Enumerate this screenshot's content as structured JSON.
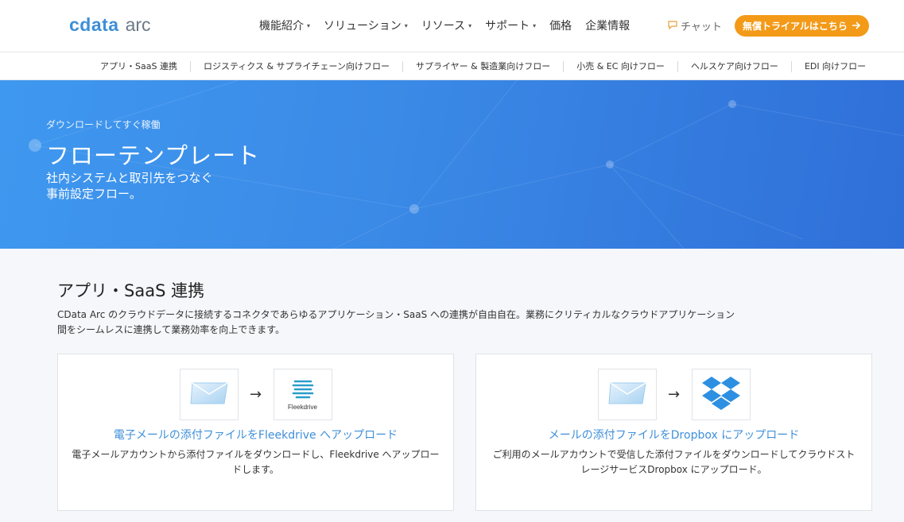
{
  "header": {
    "logo": {
      "mark": "cdata",
      "sub": "arc"
    },
    "nav": [
      {
        "label": "機能紹介",
        "has_caret": true
      },
      {
        "label": "ソリューション",
        "has_caret": true
      },
      {
        "label": "リソース",
        "has_caret": true
      },
      {
        "label": "サポート",
        "has_caret": true
      },
      {
        "label": "価格",
        "has_caret": false
      },
      {
        "label": "企業情報",
        "has_caret": false
      }
    ],
    "chat_label": "チャット",
    "trial_button": "無償トライアルはこちら",
    "caret": "▾",
    "accent_color": "#f39a18"
  },
  "subnav": [
    "アプリ・SaaS 連携",
    "ロジスティクス & サプライチェーン向けフロー",
    "サプライヤー & 製造業向けフロー",
    "小売 & EC 向けフロー",
    "ヘルスケア向けフロー",
    "EDI 向けフロー"
  ],
  "hero": {
    "kicker": "ダウンロードしてすぐ稼働",
    "title": "フローテンプレート",
    "desc_line1": "社内システムと取引先をつなぐ",
    "desc_line2": "事前設定フロー。",
    "bg_color": "#3a89e6"
  },
  "section": {
    "title": "アプリ・SaaS 連携",
    "desc": "CData Arc のクラウドデータに接続するコネクタであらゆるアプリケーション・SaaS への連携が自由自在。業務にクリティカルなクラウドアプリケーション間をシームレスに連携して業務効率を向上できます。"
  },
  "cards": [
    {
      "from_icon": "email-envelope-icon",
      "to_icon": "fleekdrive-logo-icon",
      "to_label": "Fleekdrive",
      "arrow": "→",
      "title": "電子メールの添付ファイルをFleekdrive へアップロード",
      "desc": "電子メールアカウントから添付ファイルをダウンロードし、Fleekdrive へアップロードします。"
    },
    {
      "from_icon": "email-envelope-icon",
      "to_icon": "dropbox-logo-icon",
      "arrow": "→",
      "title": "メールの添付ファイルをDropbox にアップロード",
      "desc": "ご利用のメールアカウントで受信した添付ファイルをダウンロードしてクラウドストレージサービスDropbox にアップロード。"
    }
  ],
  "link_color": "#3f8fd9"
}
